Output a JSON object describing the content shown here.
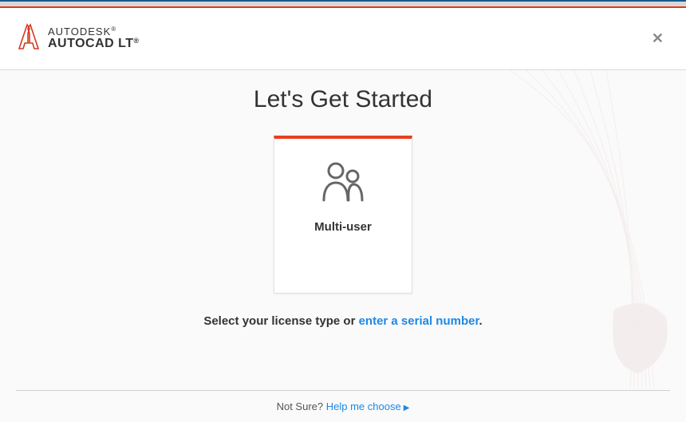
{
  "brand": {
    "company": "AUTODESK",
    "product": "AUTOCAD LT",
    "reg": "®"
  },
  "heading": "Let's Get Started",
  "card": {
    "label": "Multi-user"
  },
  "prompt": {
    "prefix": "Select your license type or ",
    "link": "enter a serial number",
    "suffix": "."
  },
  "footer": {
    "prefix": "Not Sure? ",
    "link": "Help me choose"
  }
}
